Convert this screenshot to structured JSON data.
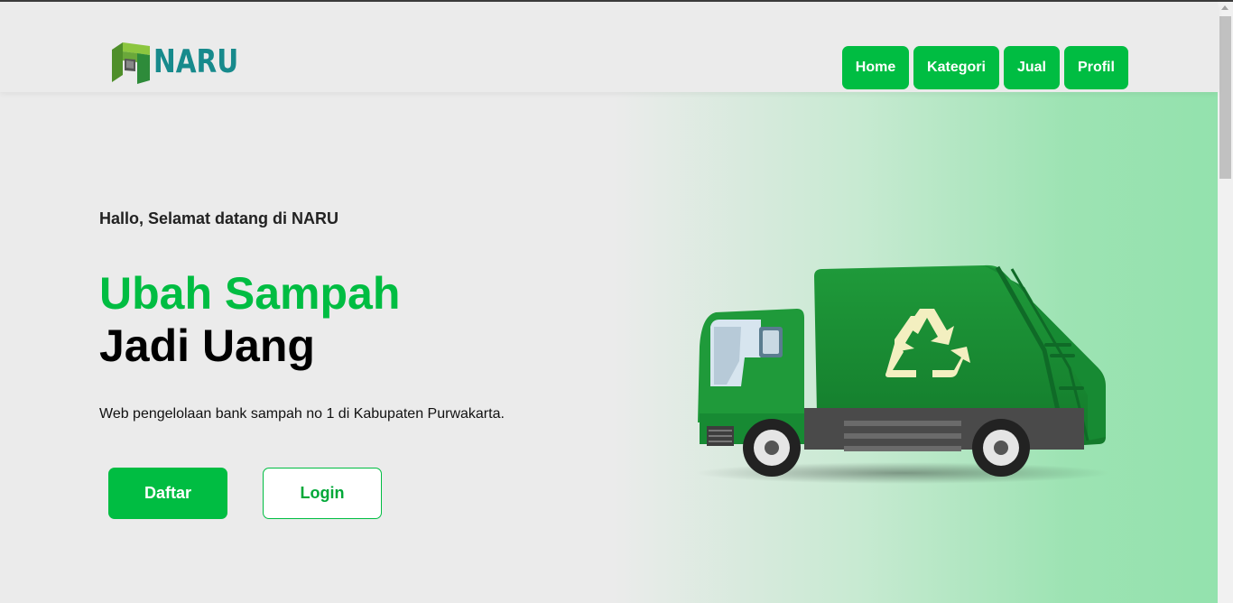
{
  "brand": {
    "name": "NARU",
    "color": "#178a8c"
  },
  "nav": {
    "items": [
      "Home",
      "Kategori",
      "Jual",
      "Profil"
    ],
    "accent": "#00bd42"
  },
  "hero": {
    "greeting": "Hallo, Selamat datang di NARU",
    "headline_line1": "Ubah Sampah",
    "headline_line2": "Jadi Uang",
    "tagline": "Web pengelolaan bank sampah no 1 di Kabupaten Purwakarta.",
    "primary_button": "Daftar",
    "secondary_button": "Login"
  },
  "illustration": {
    "icon": "garbage-truck-recycle-icon"
  },
  "colors": {
    "primary": "#00bd42",
    "background": "#ebebeb",
    "hero_gradient_end": "#93e2ad"
  }
}
